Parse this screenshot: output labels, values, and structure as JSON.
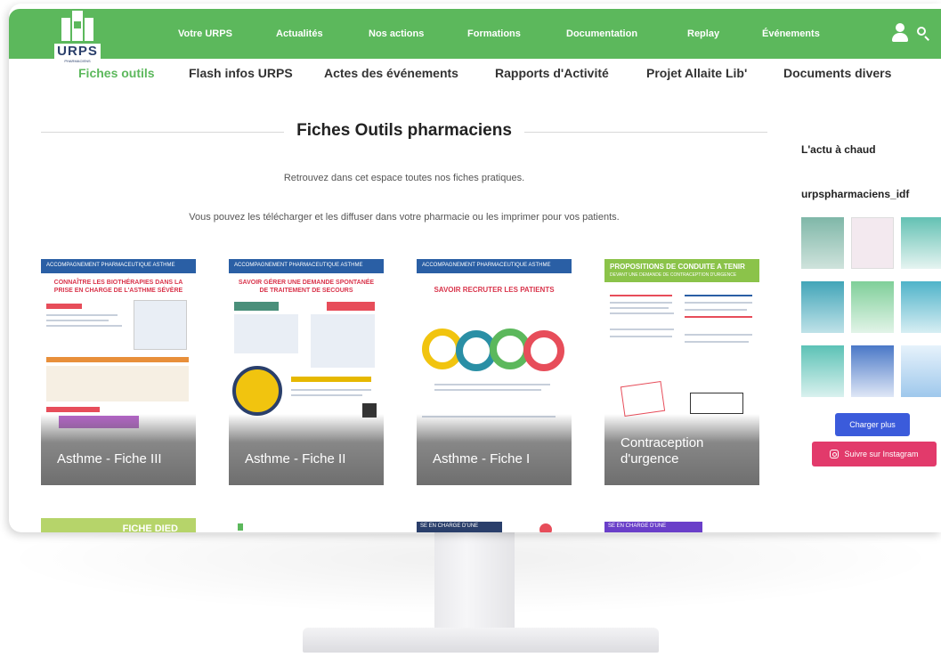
{
  "brand": {
    "logo_text": "URPS",
    "logo_sub": "PHARMACIENS",
    "accent": "#5cb85c",
    "navy": "#2a3f6b"
  },
  "nav": {
    "items": [
      {
        "label": "Votre URPS"
      },
      {
        "label": "Actualités"
      },
      {
        "label": "Nos actions"
      },
      {
        "label": "Formations"
      },
      {
        "label": "Documentation"
      },
      {
        "label": "Replay"
      },
      {
        "label": "Événements"
      }
    ],
    "icons": [
      "user-icon",
      "search-icon"
    ]
  },
  "subnav": {
    "items": [
      {
        "label": "Fiches outils",
        "active": true
      },
      {
        "label": "Flash infos URPS"
      },
      {
        "label": "Actes des événements"
      },
      {
        "label": "Rapports d'Activité"
      },
      {
        "label": "Projet Allaite Lib'"
      },
      {
        "label": "Documents divers"
      }
    ]
  },
  "main": {
    "title": "Fiches Outils pharmaciens",
    "intro1": "Retrouvez dans cet espace toutes nos fiches pratiques.",
    "intro2": "Vous pouvez les télécharger et les diffuser dans votre pharmacie ou les imprimer pour vos patients.",
    "cards": [
      {
        "caption": "Asthme - Fiche III",
        "header": "ACCOMPAGNEMENT PHARMACEUTIQUE ASTHME",
        "title": "CONNAÎTRE LES BIOTHÉRAPIES DANS LA PRISE EN CHARGE DE L'ASTHME SÉVÈRE"
      },
      {
        "caption": "Asthme - Fiche II",
        "header": "ACCOMPAGNEMENT PHARMACEUTIQUE ASTHME",
        "title": "SAVOIR GÉRER UNE DEMANDE SPONTANÉE DE TRAITEMENT DE SECOURS"
      },
      {
        "caption": "Asthme - Fiche I",
        "header": "ACCOMPAGNEMENT PHARMACEUTIQUE ASTHME",
        "title": "SAVOIR RECRUTER LES PATIENTS"
      },
      {
        "caption1": "Contraception",
        "caption2": "d'urgence",
        "header": "PROPOSITIONS DE CONDUITE A TENIR",
        "header2": "DEVANT UNE DEMANDE DE CONTRACEPTION D'URGENCE"
      }
    ],
    "partial_cards": [
      {
        "label": "FICHE DIED"
      },
      {
        "label": ""
      },
      {
        "label": "SE EN CHARGE D'UNE"
      },
      {
        "label": "SE EN CHARGE D'UNE"
      }
    ]
  },
  "sidebar": {
    "title": "L'actu à chaud",
    "handle": "urpspharmaciens_idf",
    "load_more": "Charger plus",
    "follow": "Suivre sur Instagram",
    "colors": {
      "load": "#3b5bdb",
      "follow": "#e23a6b"
    }
  }
}
